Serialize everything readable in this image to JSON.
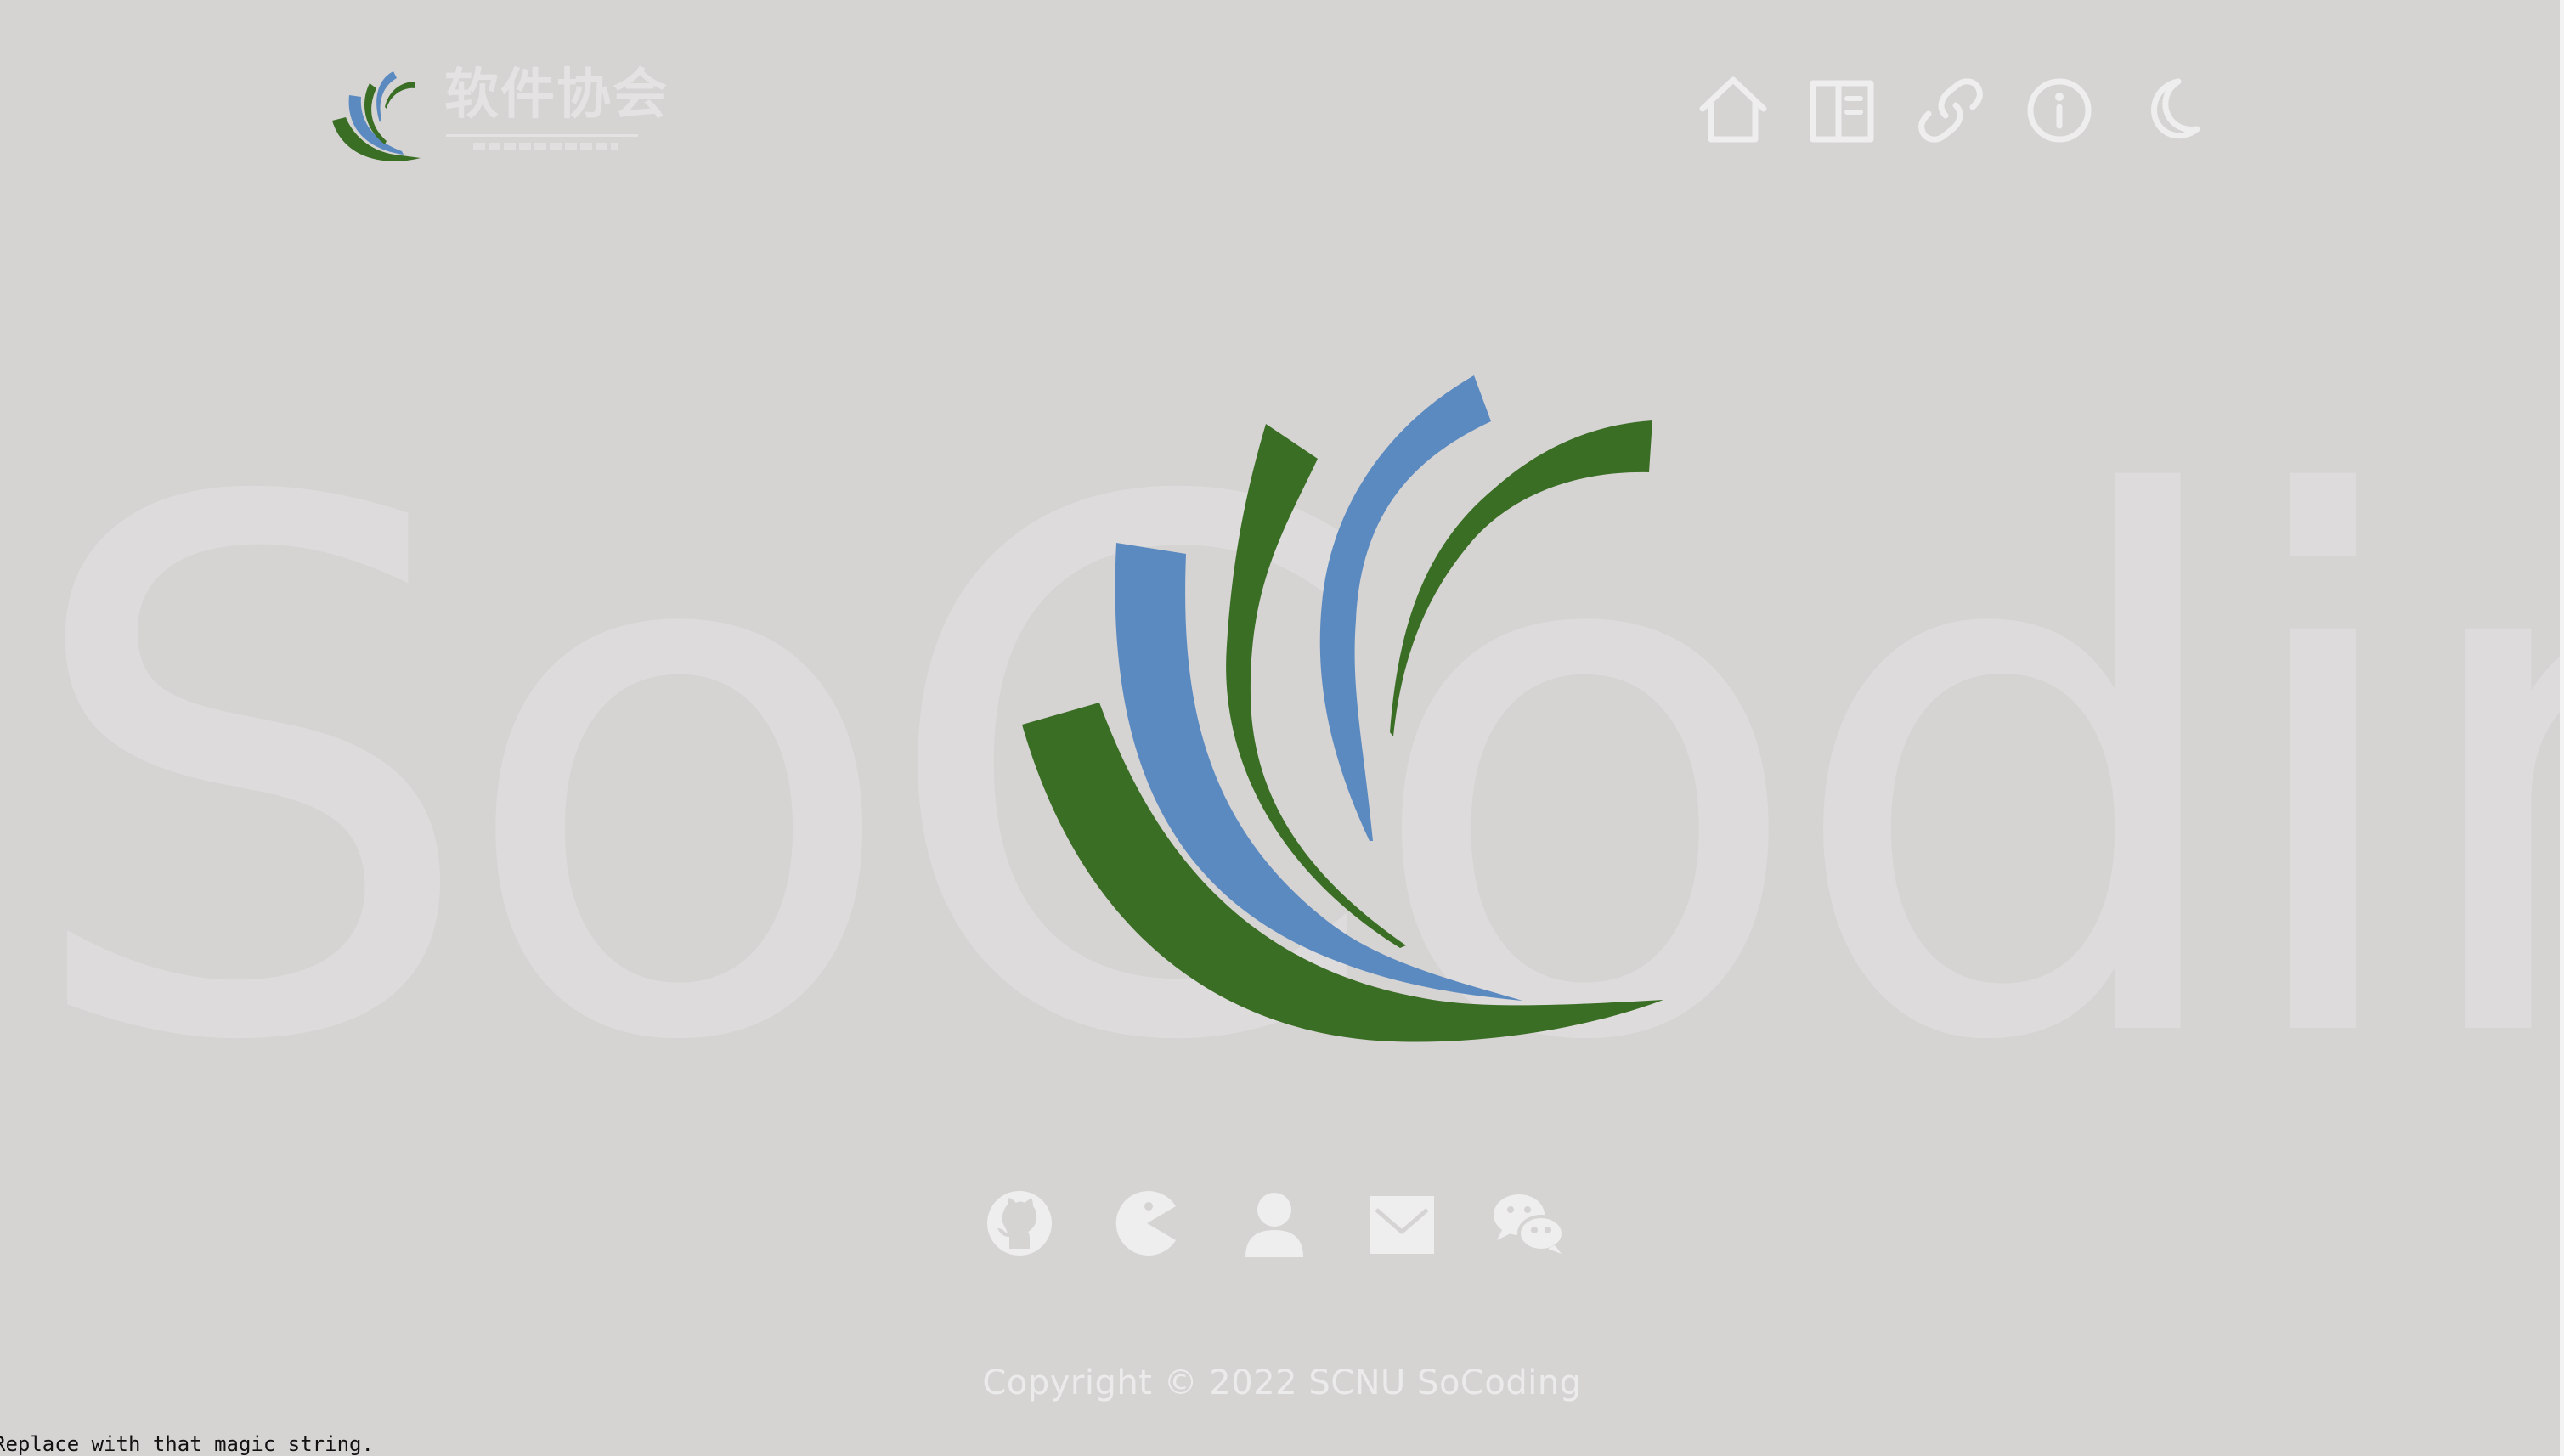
{
  "brand": {
    "logo_title": "软件协会",
    "colors": {
      "green": "#3a6e24",
      "blue": "#5b8ac1",
      "background": "#d6d3d3",
      "icon_light": "#eeeeee",
      "watermark": "#dddbdb"
    }
  },
  "watermark": {
    "text": "SoCoding"
  },
  "nav": {
    "items": [
      {
        "name": "home",
        "icon": "home-icon"
      },
      {
        "name": "docs",
        "icon": "book-icon"
      },
      {
        "name": "links",
        "icon": "link-icon"
      },
      {
        "name": "about",
        "icon": "info-icon"
      },
      {
        "name": "theme",
        "icon": "moon-icon"
      }
    ]
  },
  "social": {
    "items": [
      {
        "name": "github",
        "icon": "github-icon"
      },
      {
        "name": "game",
        "icon": "pacman-icon"
      },
      {
        "name": "profile",
        "icon": "user-icon"
      },
      {
        "name": "email",
        "icon": "mail-icon"
      },
      {
        "name": "wechat",
        "icon": "wechat-icon"
      }
    ]
  },
  "footer": {
    "copyright": "Copyright © 2022 SCNU SoCoding"
  },
  "debug": {
    "text": "Replace with that magic string."
  }
}
